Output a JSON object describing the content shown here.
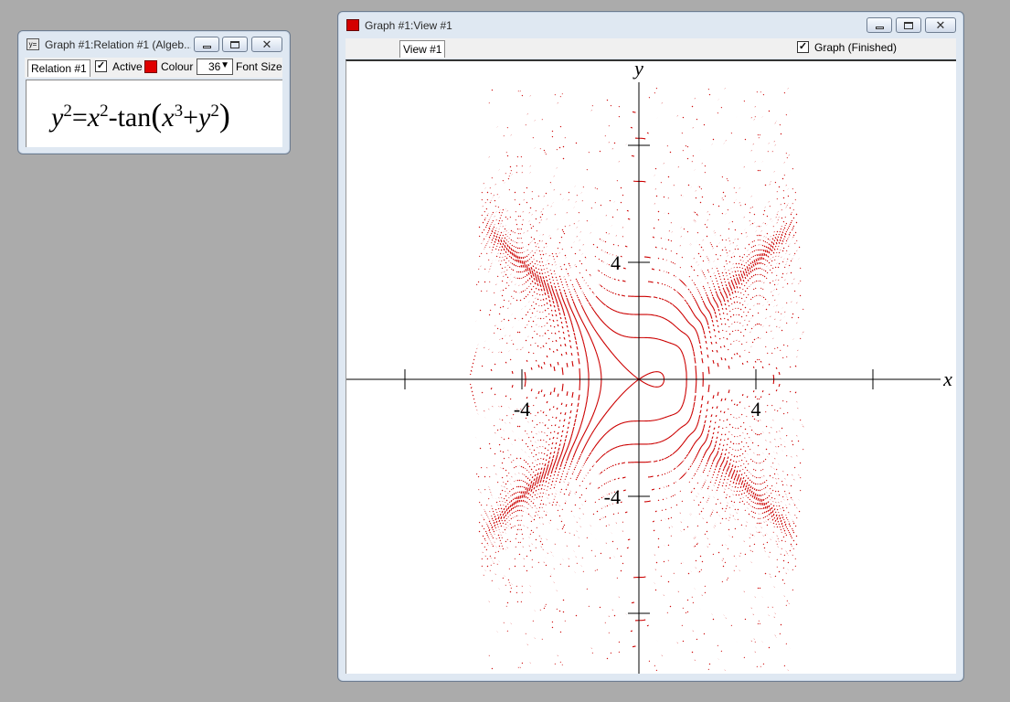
{
  "relation_window": {
    "title": "Graph #1:Relation #1 (Algeb...",
    "tab_label": "Relation #1",
    "active_label": "Active",
    "active_checked": true,
    "colour_label": "Colour",
    "colour_swatch": "#e00000",
    "font_size_value": "36",
    "font_size_label": "Font Size",
    "equation": {
      "y": "y",
      "exp2": "2",
      "eq": "=",
      "x": "x",
      "minus": "-",
      "tan": "tan",
      "lparen": "(",
      "exp3": "3",
      "plus": "+",
      "rparen": ")"
    }
  },
  "view_window": {
    "title": "Graph #1:View #1",
    "tab_label": "View #1",
    "graph_checked": true,
    "graph_status_label": "Graph (Finished)"
  },
  "graph": {
    "x_axis_label": "x",
    "y_axis_label": "y",
    "tick_labels": {
      "x_neg": "-4",
      "x_pos": "4",
      "y_pos": "4",
      "y_neg": "-4"
    },
    "x_range": [
      -10,
      10
    ],
    "y_range": [
      -10,
      10
    ],
    "curve_color": "#cc0000"
  },
  "icons": [
    "app-icon",
    "minimize-icon",
    "maximize-icon",
    "close-icon",
    "checkmark-icon",
    "dropdown-arrow-icon"
  ]
}
